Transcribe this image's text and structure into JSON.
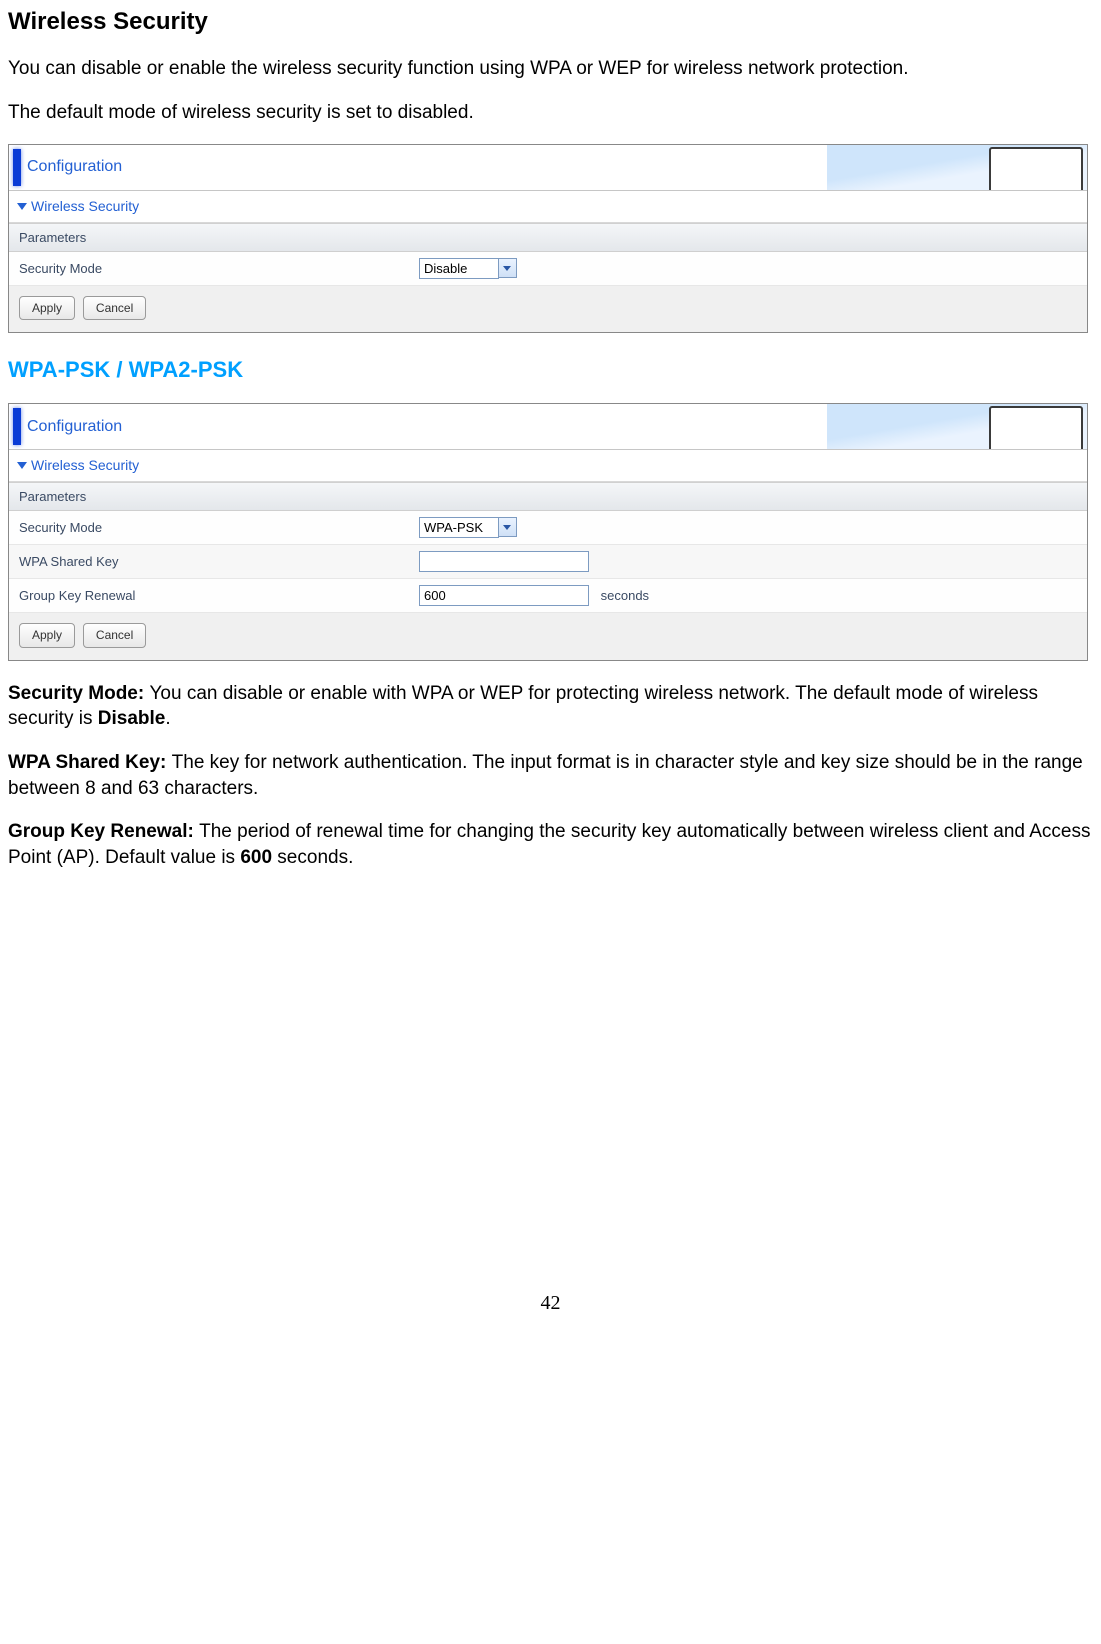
{
  "heading": "Wireless Security",
  "intro1": "You can disable or enable the wireless security function using WPA or WEP for wireless network protection.",
  "intro2": "The default mode of wireless security is set to disabled.",
  "panel1": {
    "title": "Configuration",
    "section": "Wireless Security",
    "param_label": "Parameters",
    "rows": {
      "security_mode_label": "Security Mode",
      "security_mode_value": "Disable"
    },
    "apply": "Apply",
    "cancel": "Cancel"
  },
  "subheading": "WPA-PSK / WPA2-PSK",
  "panel2": {
    "title": "Configuration",
    "section": "Wireless Security",
    "param_label": "Parameters",
    "rows": {
      "security_mode_label": "Security Mode",
      "security_mode_value": "WPA-PSK",
      "wpa_key_label": "WPA Shared Key",
      "wpa_key_value": "",
      "group_key_label": "Group Key Renewal",
      "group_key_value": "600",
      "group_key_unit": "seconds"
    },
    "apply": "Apply",
    "cancel": "Cancel"
  },
  "desc": {
    "security_mode_hdr": "Security Mode: ",
    "security_mode_body": "You can disable or enable with WPA or WEP for protecting wireless network. The default mode of wireless security is ",
    "security_mode_bold": "Disable",
    "security_mode_tail": ".",
    "wpa_key_hdr": "WPA Shared Key: ",
    "wpa_key_body": "The key for network authentication. The input format is in character style and key size should be in the range between 8 and 63 characters.",
    "group_key_hdr": "Group Key Renewal: ",
    "group_key_body1": "The period of renewal time for changing the security key automatically between wireless client and Access Point (AP). Default value is ",
    "group_key_bold": "600",
    "group_key_body2": " seconds."
  },
  "page_number": "42"
}
